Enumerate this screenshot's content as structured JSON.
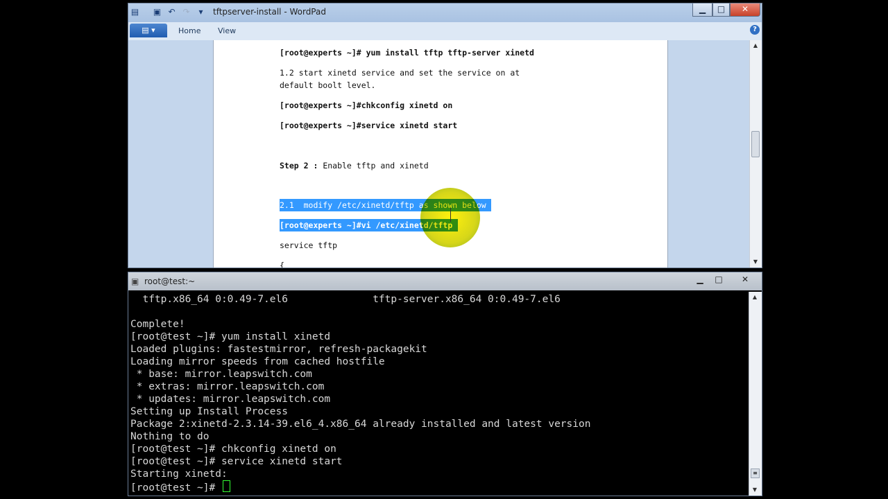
{
  "wordpad": {
    "title": "tftpserver-install - WordPad",
    "tabs": [
      "Home",
      "View"
    ],
    "file_menu_icon": "menu-icon",
    "help_glyph": "?",
    "doc_lines": [
      "[root@experts ~]# yum install tftp tftp-server xinetd",
      "1.2 start xinetd service and set the service on at",
      "default boolt level.",
      "[root@experts ~]#chkconfig xinetd on",
      "[root@experts ~]#service xinetd start",
      "Step 2 :",
      " Enable tftp and xinetd",
      "2.1  modify /etc/xinetd/tftp as shown below",
      "[root@experts ~]#vi /etc/xinetd/tftp",
      "service tftp",
      "{"
    ]
  },
  "terminal": {
    "title": "root@test:~",
    "lines": [
      "  tftp.x86_64 0:0.49-7.el6              tftp-server.x86_64 0:0.49-7.el6",
      "",
      "Complete!",
      "[root@test ~]# yum install xinetd",
      "Loaded plugins: fastestmirror, refresh-packagekit",
      "Loading mirror speeds from cached hostfile",
      " * base: mirror.leapswitch.com",
      " * extras: mirror.leapswitch.com",
      " * updates: mirror.leapswitch.com",
      "Setting up Install Process",
      "Package 2:xinetd-2.3.14-39.el6_4.x86_64 already installed and latest version",
      "Nothing to do",
      "[root@test ~]# chkconfig xinetd on",
      "[root@test ~]# service xinetd start",
      "Starting xinetd:",
      "[root@test ~]# "
    ]
  }
}
